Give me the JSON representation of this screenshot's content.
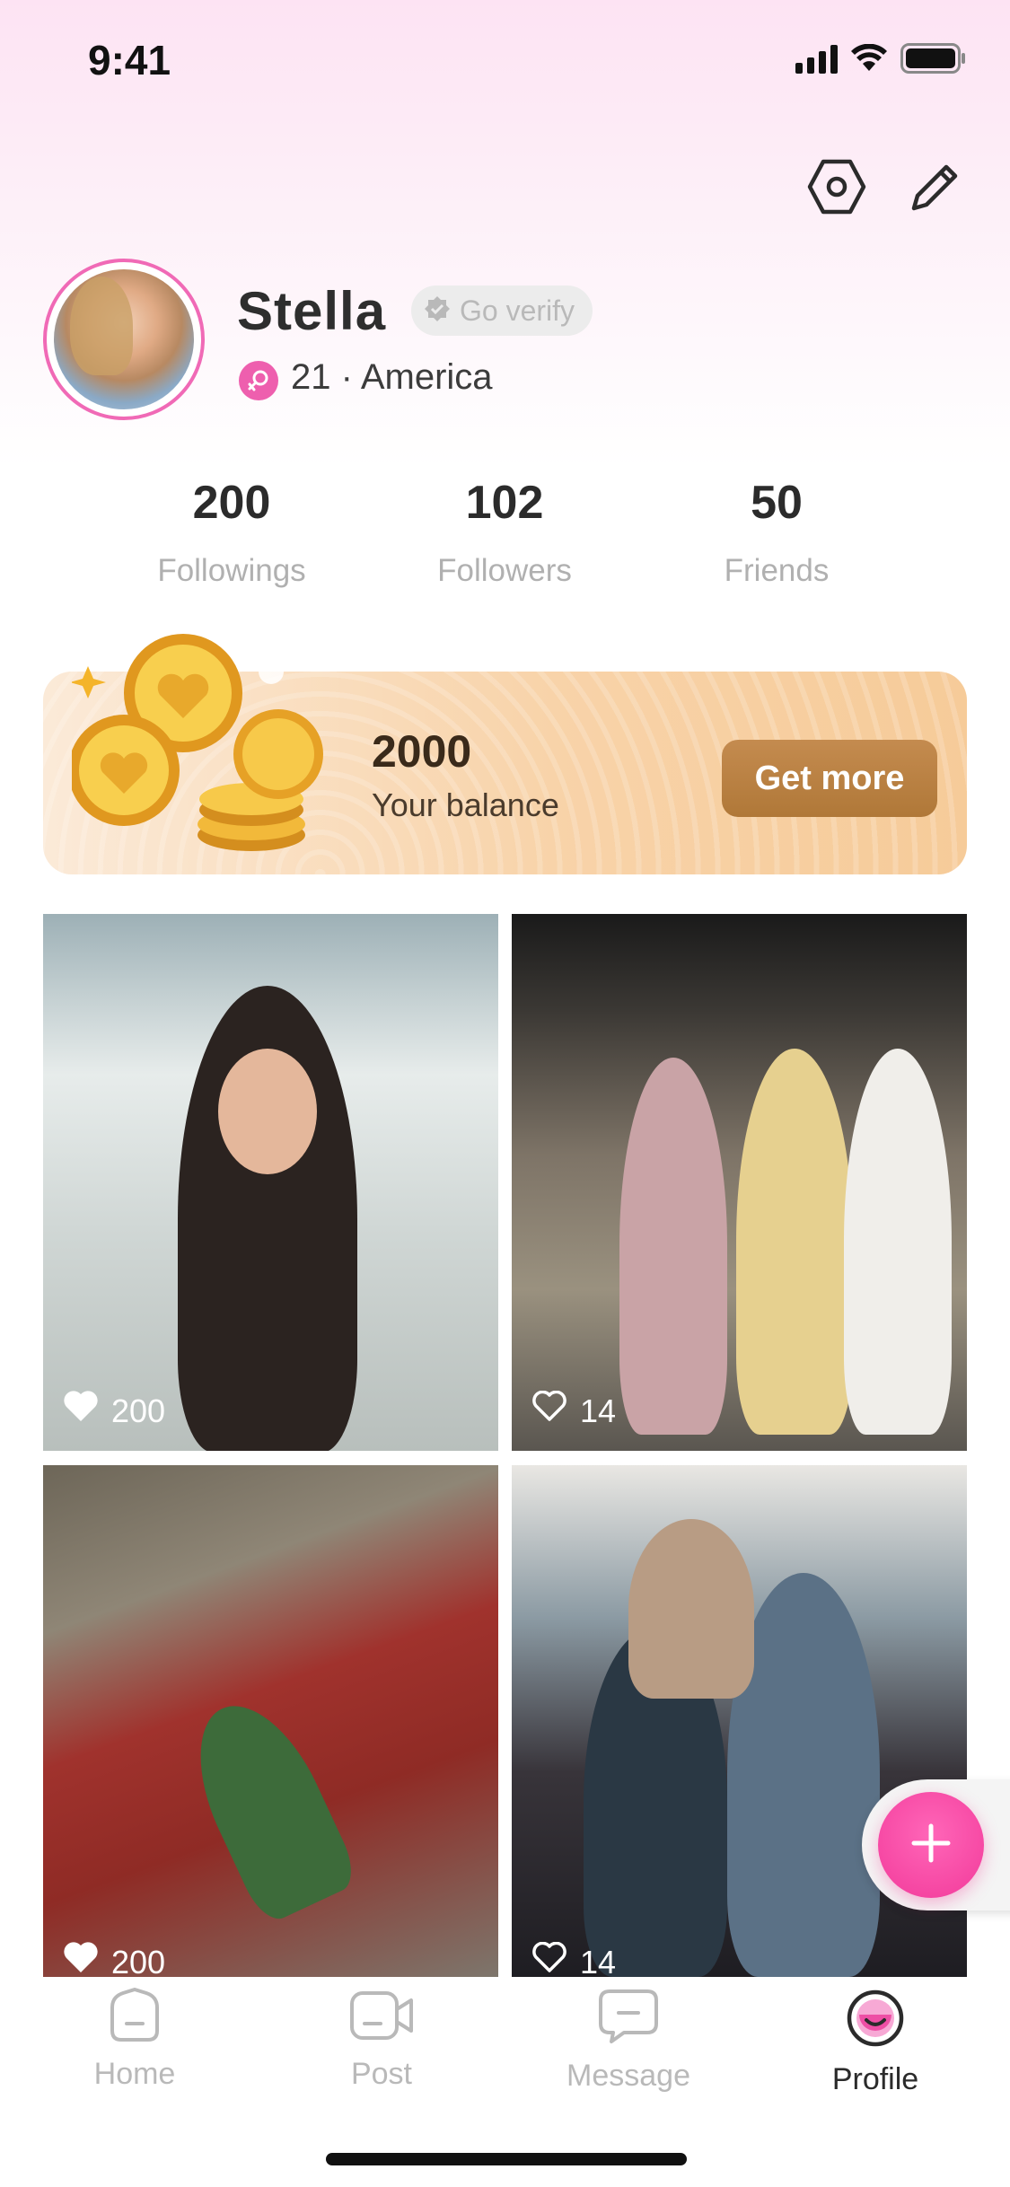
{
  "status_bar": {
    "time": "9:41"
  },
  "profile": {
    "name": "Stella",
    "verify_label": "Go verify",
    "meta": "21 · America"
  },
  "stats": [
    {
      "value": "200",
      "label": "Followings"
    },
    {
      "value": "102",
      "label": "Followers"
    },
    {
      "value": "50",
      "label": "Friends"
    }
  ],
  "balance": {
    "value": "2000",
    "label": "Your balance",
    "button_label": "Get more"
  },
  "posts": [
    {
      "likes": "200",
      "liked": true
    },
    {
      "likes": "14",
      "liked": false
    },
    {
      "likes": "200",
      "liked": true
    },
    {
      "likes": "14",
      "liked": false
    }
  ],
  "nav": {
    "items": [
      {
        "label": "Home",
        "icon": "home-icon"
      },
      {
        "label": "Post",
        "icon": "video-camera-icon"
      },
      {
        "label": "Message",
        "icon": "message-icon"
      },
      {
        "label": "Profile",
        "icon": "profile-icon"
      }
    ],
    "active": "Profile"
  },
  "colors": {
    "accent": "#f23a9a",
    "brand_pink_bg": "#fde3f3",
    "balance_button": "#b07838"
  }
}
